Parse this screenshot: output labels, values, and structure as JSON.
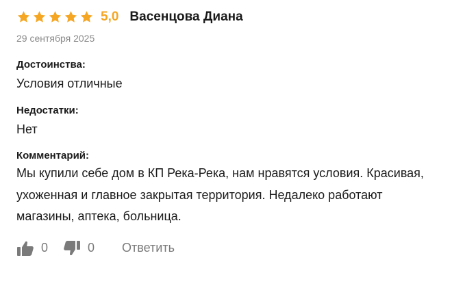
{
  "review": {
    "stars": 5,
    "max_stars": 5,
    "star_color": "#f5a623",
    "rating": "5,0",
    "author": "Васенцова Диана",
    "date": "29 сентября 2025",
    "pros": {
      "label": "Достоинства:",
      "text": "Условия отличные"
    },
    "cons": {
      "label": "Недостатки:",
      "text": "Нет"
    },
    "comment": {
      "label": "Комментарий:",
      "text": "Мы купили себе дом в КП Река-Река, нам нравятся условия. Красивая, ухоженная и главное закрытая территория. Недалеко работают магазины, аптека, больница."
    },
    "actions": {
      "like_icon": "thumbs-up-icon",
      "like_count": "0",
      "dislike_icon": "thumbs-down-icon",
      "dislike_count": "0",
      "reply_label": "Ответить"
    }
  }
}
